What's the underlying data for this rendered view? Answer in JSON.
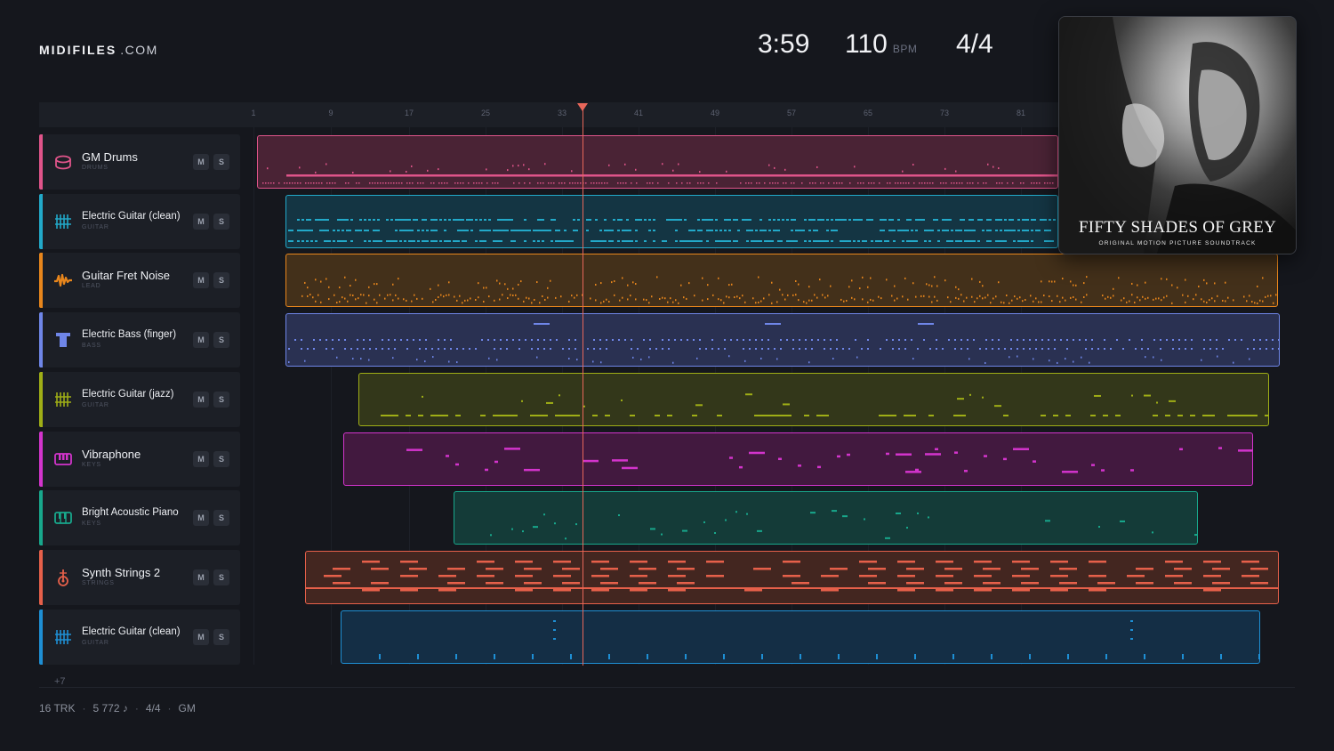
{
  "brand": {
    "name": "MIDIFILES",
    "domain": ".COM"
  },
  "stats": {
    "time": "3:59",
    "tempo": "110",
    "tempo_unit": "BPM",
    "meter": "4/4"
  },
  "ruler": {
    "ticks": [
      "1",
      "9",
      "17",
      "25",
      "33",
      "41",
      "49",
      "57",
      "65",
      "73",
      "81"
    ]
  },
  "playhead_position": "measure 35",
  "tracks": [
    {
      "name": "GM Drums",
      "category": "DRUMS",
      "color": "#e0548a",
      "icon": "drum-icon",
      "mute": "M",
      "solo": "S",
      "lane_bg": "#4a2335"
    },
    {
      "name": "Electric Guitar (clean)",
      "category": "GUITAR",
      "color": "#22a9c9",
      "icon": "guitar-grid-icon",
      "mute": "M",
      "solo": "S",
      "lane_bg": "#143543"
    },
    {
      "name": "Guitar Fret Noise",
      "category": "LEAD",
      "color": "#e8861c",
      "icon": "waveform-icon",
      "mute": "M",
      "solo": "S",
      "lane_bg": "#43301a"
    },
    {
      "name": "Electric Bass (finger)",
      "category": "BASS",
      "color": "#6f86e8",
      "icon": "bass-icon",
      "mute": "M",
      "solo": "S",
      "lane_bg": "#2a3152"
    },
    {
      "name": "Electric Guitar (jazz)",
      "category": "GUITAR",
      "color": "#9fae16",
      "icon": "guitar-grid-icon",
      "mute": "M",
      "solo": "S",
      "lane_bg": "#33371a"
    },
    {
      "name": "Vibraphone",
      "category": "KEYS",
      "color": "#d334cc",
      "icon": "keyboard-icon",
      "mute": "M",
      "solo": "S",
      "lane_bg": "#42193f"
    },
    {
      "name": "Bright Acoustic Piano",
      "category": "KEYS",
      "color": "#18a88c",
      "icon": "piano-icon",
      "mute": "M",
      "solo": "S",
      "lane_bg": "#143b38"
    },
    {
      "name": "Synth Strings 2",
      "category": "STRINGS",
      "color": "#e6604a",
      "icon": "violin-icon",
      "mute": "M",
      "solo": "S",
      "lane_bg": "#432620"
    },
    {
      "name": "Electric Guitar (clean)",
      "category": "GUITAR",
      "color": "#1e8fd4",
      "icon": "guitar-grid-icon",
      "mute": "M",
      "solo": "S",
      "lane_bg": "#142e45"
    }
  ],
  "more_tracks": "+7",
  "footer": {
    "tracks": "16 TRK",
    "notes": "5 772 ♪",
    "meter": "4/4",
    "standard": "GM",
    "separator": "·"
  },
  "album": {
    "title": "FIFTY SHADES OF GREY",
    "subtitle": "ORIGINAL MOTION PICTURE SOUNDTRACK"
  }
}
